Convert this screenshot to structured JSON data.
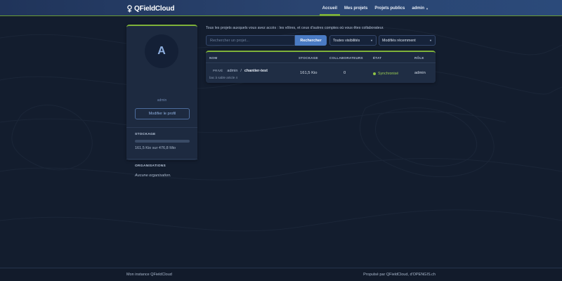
{
  "brand": {
    "name": "QFieldCloud",
    "logo_icon": "qfield-logo-icon"
  },
  "nav": {
    "items": [
      {
        "label": "Accueil",
        "active": true
      },
      {
        "label": "Mes projets",
        "active": false
      },
      {
        "label": "Projets publics",
        "active": false
      }
    ],
    "user_menu": {
      "label": "admin",
      "icon": "chevron-down-icon"
    }
  },
  "profile": {
    "avatar_letter": "A",
    "username": "admin",
    "edit_button": "Modifier le profil",
    "storage": {
      "title": "STOCKAGE",
      "usage_text": "161,5 Kio sur 476,8 Mio",
      "used_fraction": 0.0003
    },
    "organizations": {
      "title": "ORGANISATIONS",
      "empty_text": "Aucune organisation."
    }
  },
  "main": {
    "intro": "Tous les projets auxquels vous avez accès : les vôtres, et ceux d'autres comptes où vous êtes collaborateur.",
    "search": {
      "placeholder": "Rechercher un projet...",
      "value": "",
      "button": "Rechercher"
    },
    "visibility_filter": {
      "selected": "Toutes visibilités",
      "icon": "chevron-down-icon"
    },
    "sort_filter": {
      "selected": "Modifiés récemment",
      "icon": "chevron-down-icon"
    }
  },
  "table": {
    "headers": {
      "name": "NOM",
      "storage": "STOCKAGE",
      "collaborators": "COLLABORATEURS",
      "status": "ÉTAT",
      "role": "RÔLE"
    },
    "rows": [
      {
        "visibility": "PRIVÉ",
        "owner": "admin",
        "separator": "/",
        "name": "chantier-test",
        "description": "bac à sable article 4",
        "storage": "161,5 Kio",
        "collaborators": "0",
        "status": "Synchronisé",
        "role": "admin"
      }
    ]
  },
  "footer": {
    "left": "Mon instance QFieldCloud",
    "right": "Propulsé par QFieldCloud, d'OPENGIS.ch"
  },
  "colors": {
    "accent_green": "#7fb33a",
    "primary_blue": "#4a7bc4",
    "status_ok": "#8fc347",
    "background": "#131d2e",
    "card": "#1d2a40"
  }
}
